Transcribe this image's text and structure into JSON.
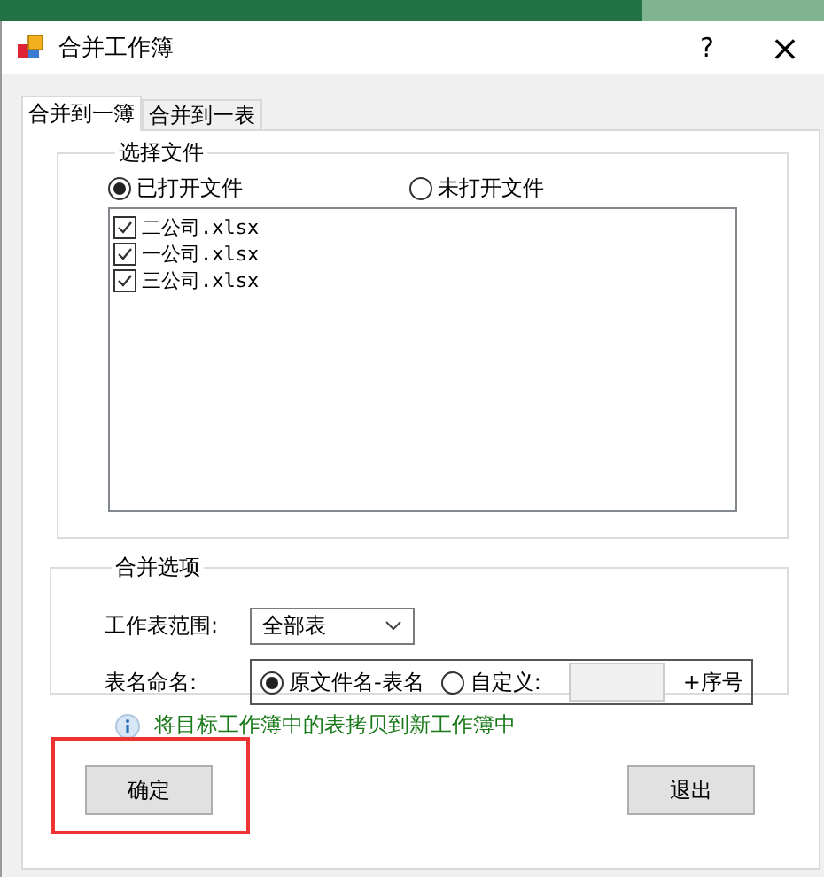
{
  "window": {
    "title": "合并工作簿",
    "help": "?",
    "close": "×"
  },
  "tabs": [
    {
      "label": "合并到一簿",
      "selected": true
    },
    {
      "label": "合并到一表",
      "selected": false
    }
  ],
  "file_group": {
    "title": "选择文件",
    "sources": [
      {
        "label": "已打开文件",
        "selected": true
      },
      {
        "label": "未打开文件",
        "selected": false
      }
    ],
    "files": [
      {
        "name": "二公司.xlsx",
        "checked": true
      },
      {
        "name": "一公司.xlsx",
        "checked": true
      },
      {
        "name": "三公司.xlsx",
        "checked": true
      }
    ]
  },
  "options_group": {
    "title": "合并选项",
    "range_label": "工作表范围:",
    "range_value": "全部表",
    "naming_label": "表名命名:",
    "naming": [
      {
        "label": "原文件名-表名",
        "selected": true
      },
      {
        "label": "自定义:",
        "selected": false
      }
    ],
    "suffix": "+序号"
  },
  "info": "将目标工作簿中的表拷贝到新工作簿中",
  "buttons": [
    {
      "label": "确定",
      "highlighted": true
    },
    {
      "label": "退出",
      "highlighted": false
    }
  ]
}
